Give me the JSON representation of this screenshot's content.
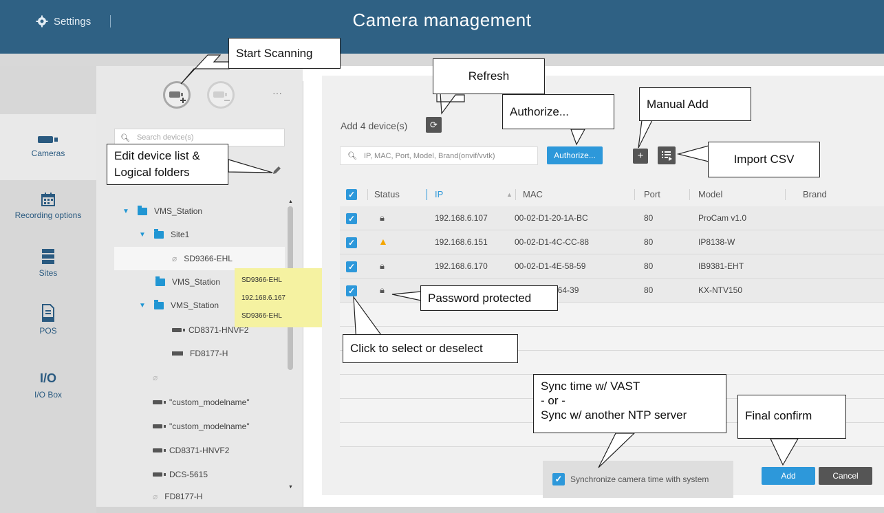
{
  "header": {
    "settings_label": "Settings",
    "title": "Camera management"
  },
  "nav": {
    "items": [
      {
        "label": "Cameras",
        "icon": "camera-icon"
      },
      {
        "label": "Recording options",
        "icon": "calendar-icon"
      },
      {
        "label": "Sites",
        "icon": "server-icon"
      },
      {
        "label": "POS",
        "icon": "receipt-icon"
      },
      {
        "label": "I/O Box",
        "icon": "io-icon",
        "icon_text": "I/O"
      }
    ]
  },
  "tree": {
    "search_placeholder": "Search device(s)",
    "more_label": "···",
    "rows": [
      {
        "label": "VMS_Station"
      },
      {
        "label": "Site1"
      },
      {
        "label": "SD9366-EHL"
      },
      {
        "label": "VMS_Station"
      },
      {
        "label": "VMS_Station"
      },
      {
        "label": "CD8371-HNVF2"
      },
      {
        "label": "FD8177-H"
      },
      {
        "label": ""
      },
      {
        "label": "\"custom_modelname\""
      },
      {
        "label": "\"custom_modelname\""
      },
      {
        "label": "CD8371-HNVF2"
      },
      {
        "label": "DCS-5615"
      },
      {
        "label": "FD8177-H"
      }
    ],
    "tooltip": {
      "line1": "SD9366-EHL",
      "line2": "192.168.6.167",
      "line3": "SD9366-EHL"
    }
  },
  "main": {
    "add_count": "Add 4 device(s)",
    "filter_placeholder": "IP, MAC, Port, Model, Brand(onvif/vvtk)",
    "authorize_label": "Authorize...",
    "manual_add_label": "+",
    "columns": [
      "Status",
      "IP",
      "MAC",
      "Port",
      "Model",
      "Brand"
    ],
    "devices": [
      {
        "status": "locked",
        "ip": "192.168.6.107",
        "mac": "00-02-D1-20-1A-BC",
        "port": "80",
        "model": "ProCam v1.0",
        "brand": ""
      },
      {
        "status": "warning",
        "ip": "192.168.6.151",
        "mac": "00-02-D1-4C-CC-88",
        "port": "80",
        "model": "IP8138-W",
        "brand": ""
      },
      {
        "status": "locked",
        "ip": "192.168.6.170",
        "mac": "00-02-D1-4E-58-59",
        "port": "80",
        "model": "IB9381-EHT",
        "brand": ""
      },
      {
        "status": "locked",
        "ip": "",
        "mac": "3B-64-39",
        "port": "80",
        "model": "KX-NTV150",
        "brand": ""
      }
    ],
    "sync_label": "Synchronize camera time with system",
    "add_button": "Add",
    "cancel_button": "Cancel"
  },
  "callouts": {
    "start_scanning": "Start Scanning",
    "refresh": "Refresh",
    "authorize": "Authorize...",
    "manual_add": "Manual Add",
    "import_csv": "Import CSV",
    "edit_device_list_1": "Edit device list &",
    "edit_device_list_2": "Logical folders",
    "password_protected": "Password protected",
    "click_select": "Click to select or deselect",
    "sync_1": "Sync time w/ VAST",
    "sync_2": "- or -",
    "sync_3": "Sync w/ another NTP server",
    "final_confirm": "Final confirm"
  },
  "colors": {
    "header": "#2f6184",
    "accent": "#2d98da",
    "folder": "#2196d3",
    "warning": "#f4a500",
    "tooltip": "#f5f2a1"
  }
}
